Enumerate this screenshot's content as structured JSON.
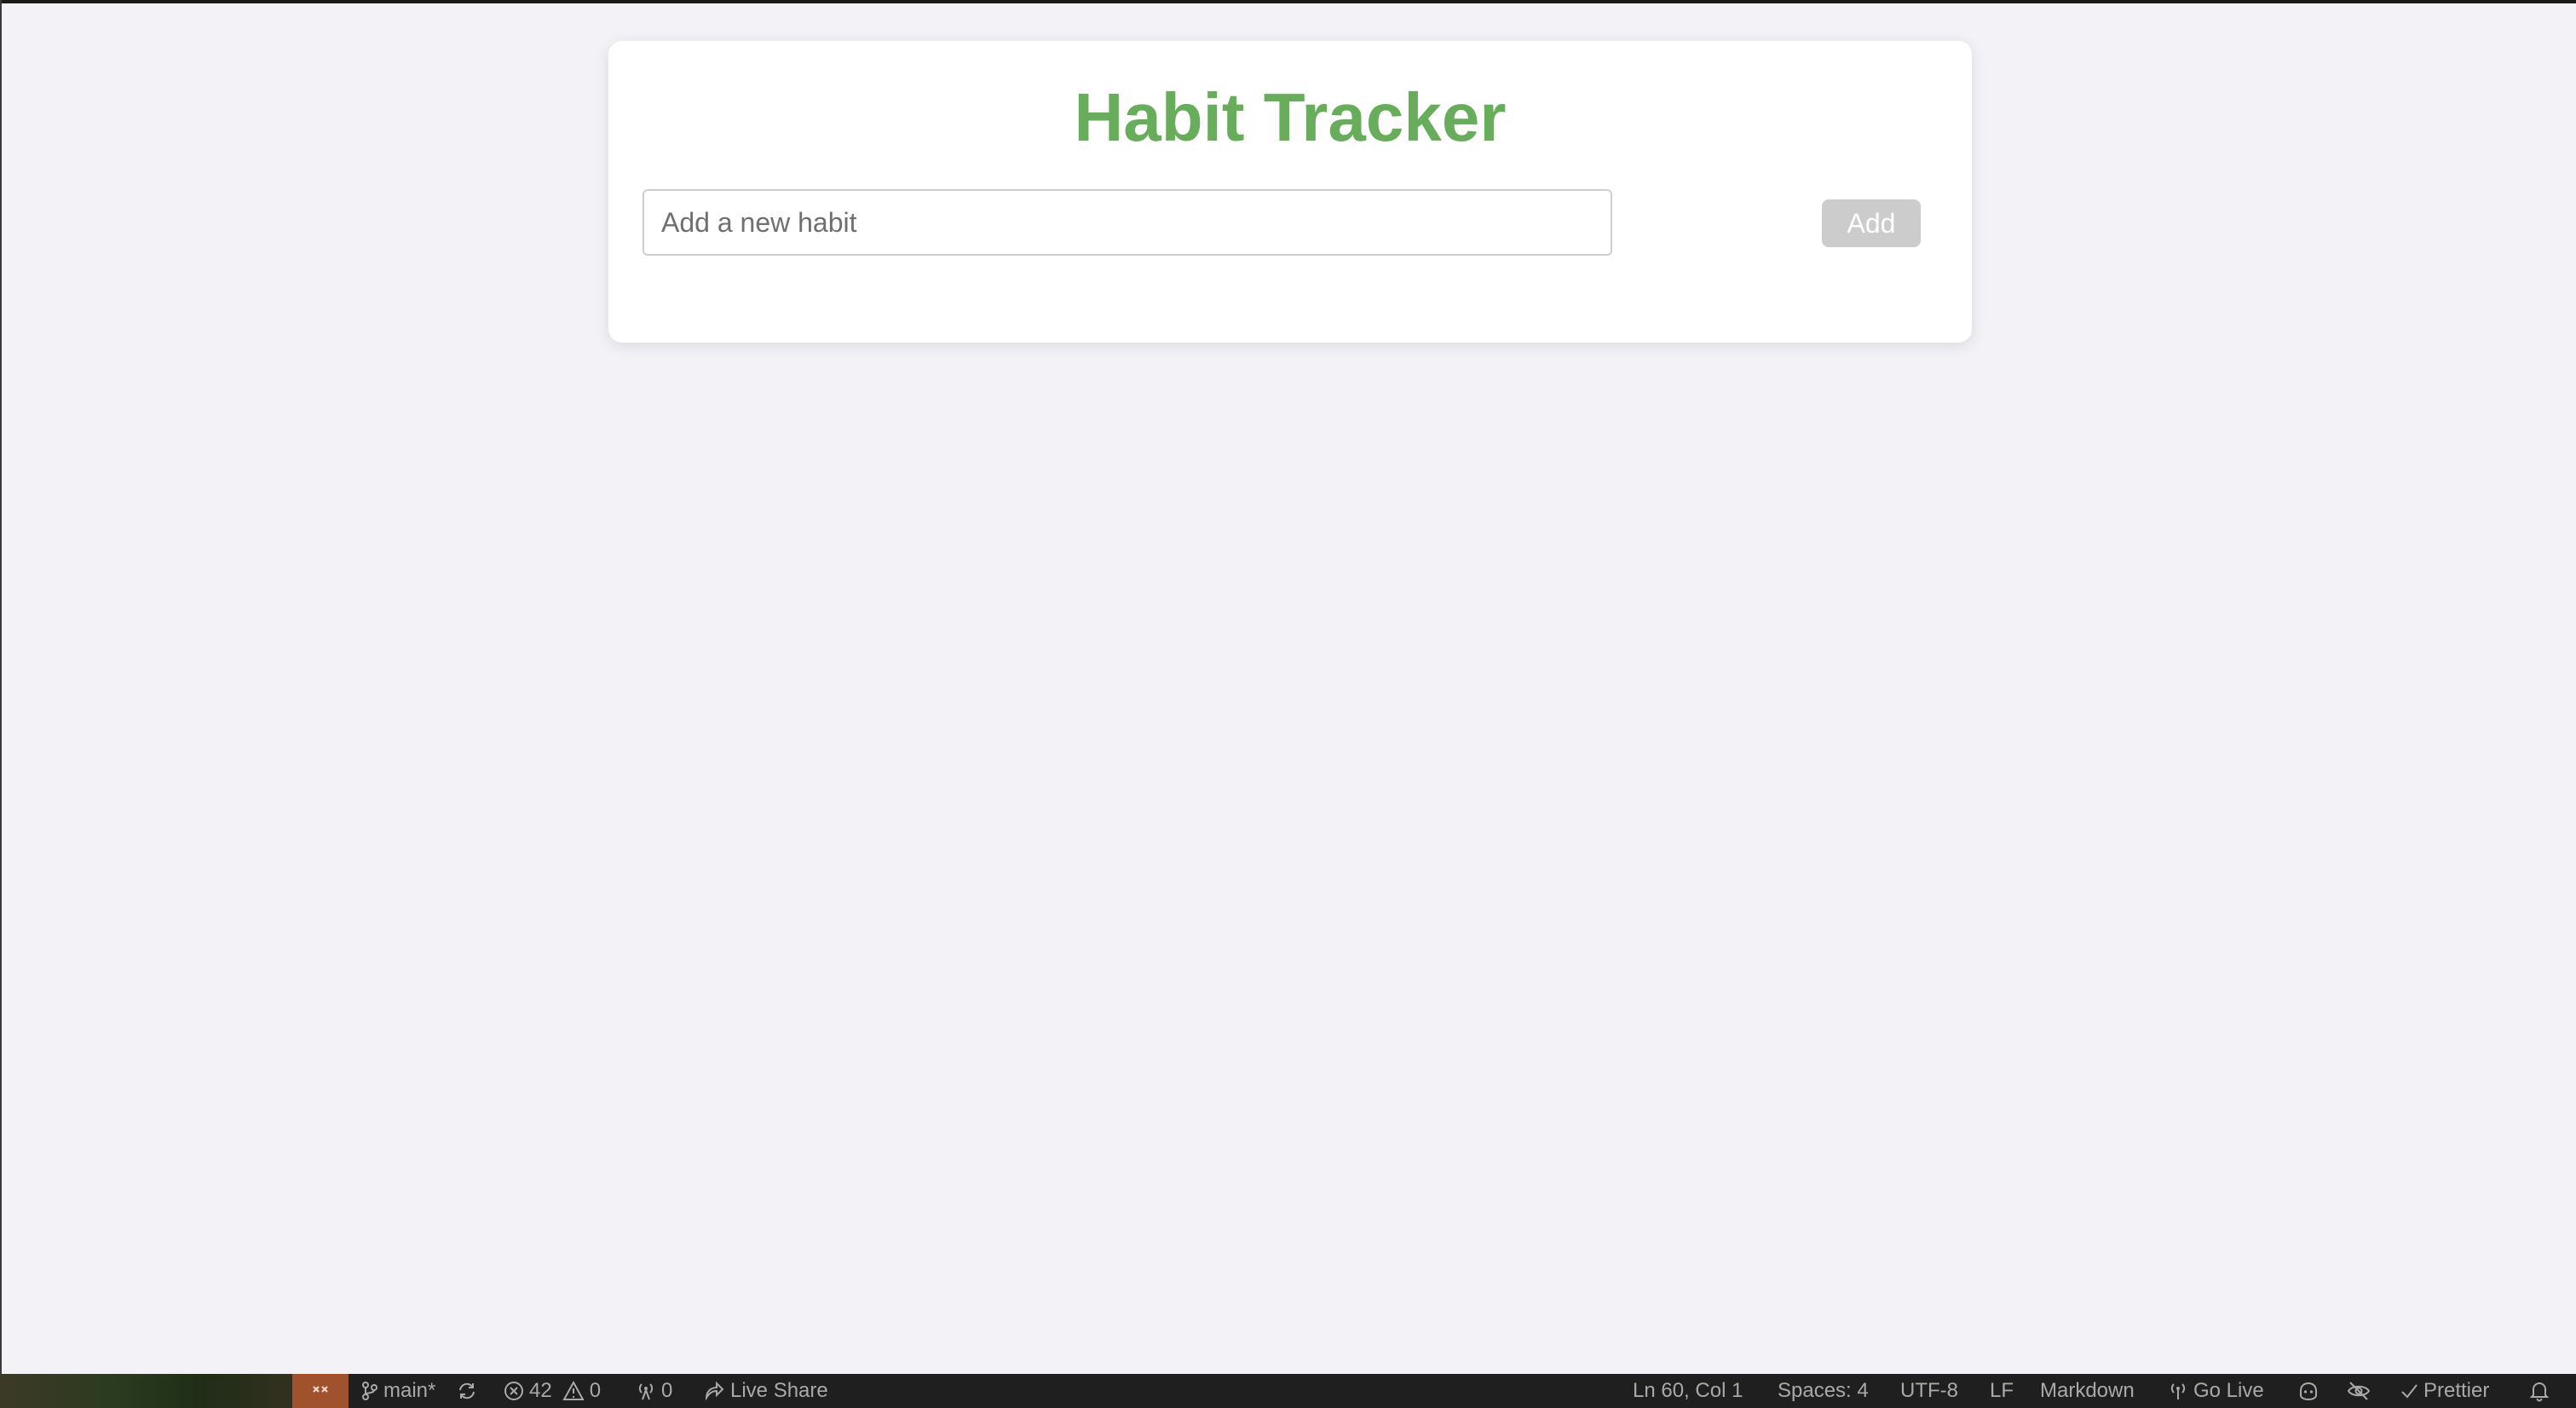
{
  "app": {
    "title": "Habit Tracker",
    "input": {
      "placeholder": "Add a new habit",
      "value": ""
    },
    "add_label": "Add"
  },
  "status_bar": {
    "remote_icon": "remote-window-icon",
    "branch": "main*",
    "errors": "42",
    "warnings": "0",
    "ports": "0",
    "live_share": "Live Share",
    "cursor_position": "Ln 60, Col 1",
    "indentation": "Spaces: 4",
    "encoding": "UTF-8",
    "eol": "LF",
    "language": "Markdown",
    "go_live": "Go Live",
    "prettier": "Prettier"
  },
  "colors": {
    "title_green": "#67ad5b",
    "page_background": "#f3f2f7",
    "add_button": "#cccccc",
    "remote_indicator": "#a0522d"
  }
}
